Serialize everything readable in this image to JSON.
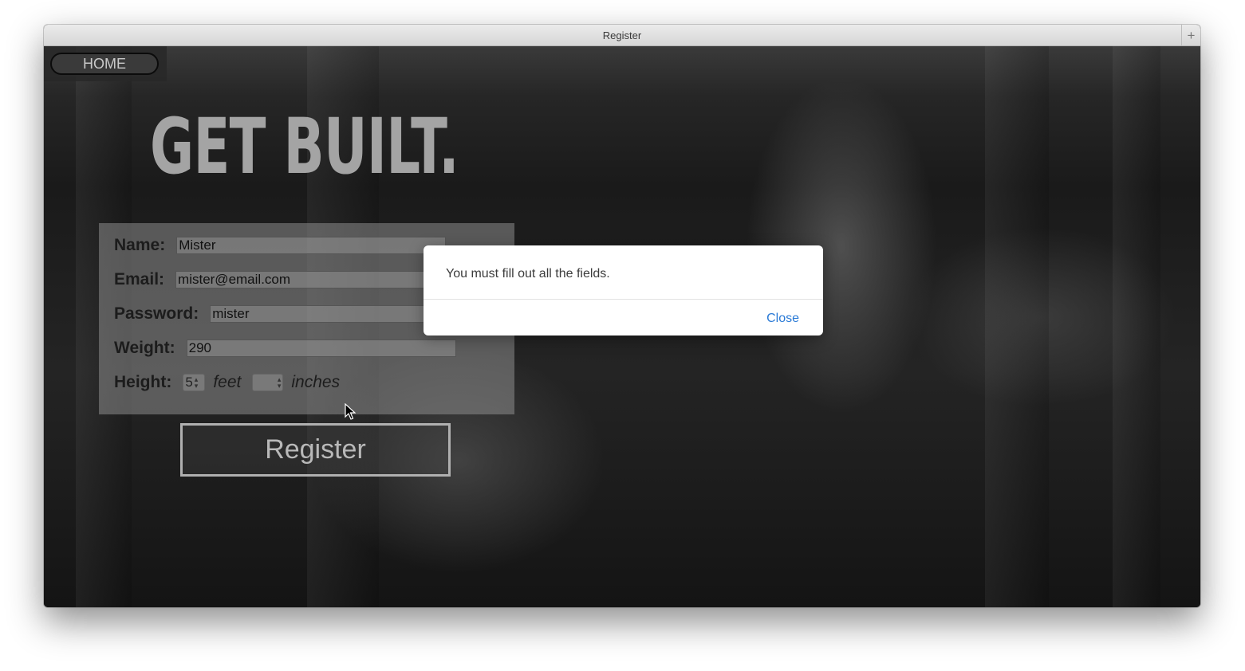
{
  "window": {
    "title": "Register",
    "new_tab_symbol": "+"
  },
  "nav": {
    "home_label": "HOME"
  },
  "hero": {
    "headline": "GET BUILT."
  },
  "form": {
    "name_label": "Name:",
    "name_value": "Mister",
    "email_label": "Email:",
    "email_value": "mister@email.com",
    "password_label": "Password:",
    "password_value": "mister",
    "weight_label": "Weight:",
    "weight_value": "290",
    "height_label": "Height:",
    "height_feet_value": "5",
    "feet_unit": "feet",
    "height_inches_value": "",
    "inches_unit": "inches",
    "register_label": "Register"
  },
  "alert": {
    "message": "You must fill out all the fields.",
    "close_label": "Close"
  },
  "colors": {
    "link_blue": "#2a7ad6",
    "headline_gray": "#a4a4a4"
  }
}
